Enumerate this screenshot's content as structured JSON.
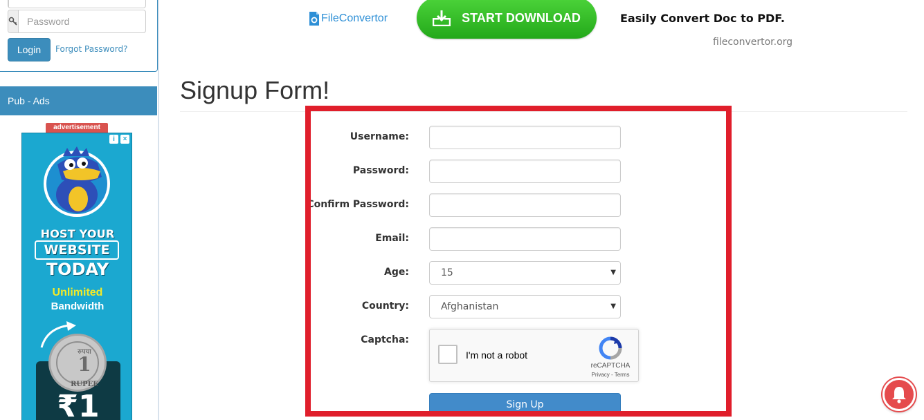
{
  "login": {
    "password_placeholder": "Password",
    "login_button": "Login",
    "forgot_link": "Forgot Password?"
  },
  "sidebar": {
    "pub_ads_title": "Pub - Ads",
    "ad_badge": "advertisement",
    "ad": {
      "line1": "HOST YOUR",
      "line2": "WEBSITE",
      "line3": "TODAY",
      "line4": "Unlimited",
      "line5": "Bandwidth",
      "coin_top": "रुपया",
      "coin_number": "1",
      "coin_label": "RUPEE",
      "price": "₹1"
    }
  },
  "banner": {
    "logo_text": "FileConvertor",
    "download_button": "START DOWNLOAD",
    "tagline": "Easily Convert Doc to PDF.",
    "domain": "fileconvertor.org"
  },
  "signup": {
    "title": "Signup Form!",
    "labels": {
      "username": "Username:",
      "password": "Password:",
      "confirm_password": "Confirm Password:",
      "email": "Email:",
      "age": "Age:",
      "country": "Country:",
      "captcha": "Captcha:"
    },
    "age_selected": "15",
    "country_selected": "Afghanistan",
    "captcha": {
      "label": "I'm not a robot",
      "brand": "reCAPTCHA",
      "terms": "Privacy - Terms"
    },
    "submit": "Sign Up"
  },
  "colors": {
    "primary": "#3c8dbc",
    "download_green": "#2fbf22",
    "highlight_red": "#e01e2b",
    "notification_red": "#e54b4d"
  }
}
